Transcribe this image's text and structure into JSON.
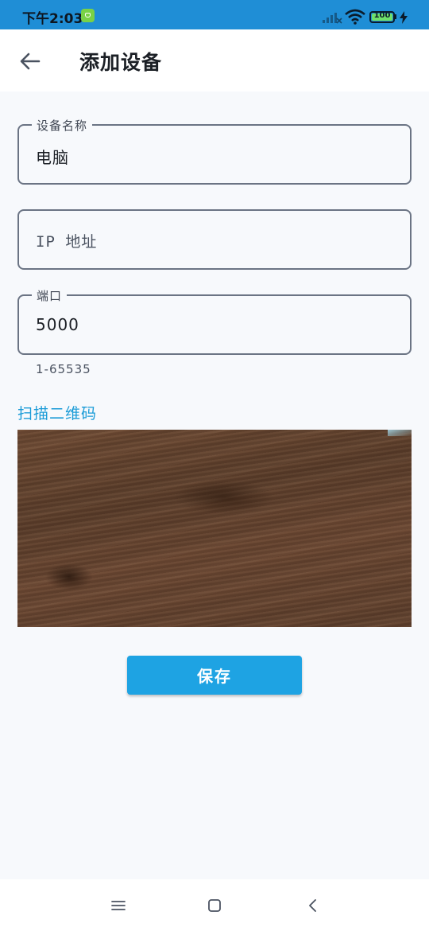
{
  "status_bar": {
    "time": "下午2:03",
    "battery_level": "100",
    "icons": [
      "app-notification-icon",
      "signal-icon",
      "wifi-icon",
      "battery-icon",
      "charging-bolt-icon"
    ]
  },
  "header": {
    "back_icon": "arrow-left-icon",
    "title": "添加设备"
  },
  "form": {
    "device_name": {
      "label": "设备名称",
      "value": "电脑"
    },
    "ip_address": {
      "placeholder": "IP 地址",
      "value": ""
    },
    "port": {
      "label": "端口",
      "value": "5000",
      "helper": "1-65535"
    },
    "scan_label": "扫描二维码",
    "save_label": "保存"
  },
  "navigation": {
    "icons": [
      "menu-icon",
      "home-icon",
      "back-icon"
    ]
  },
  "colors": {
    "status_bar": "#1f8ed6",
    "accent": "#1ea3e3",
    "link": "#1a9bd7",
    "background": "#f7f9fc",
    "field_border": "#6b7484"
  }
}
